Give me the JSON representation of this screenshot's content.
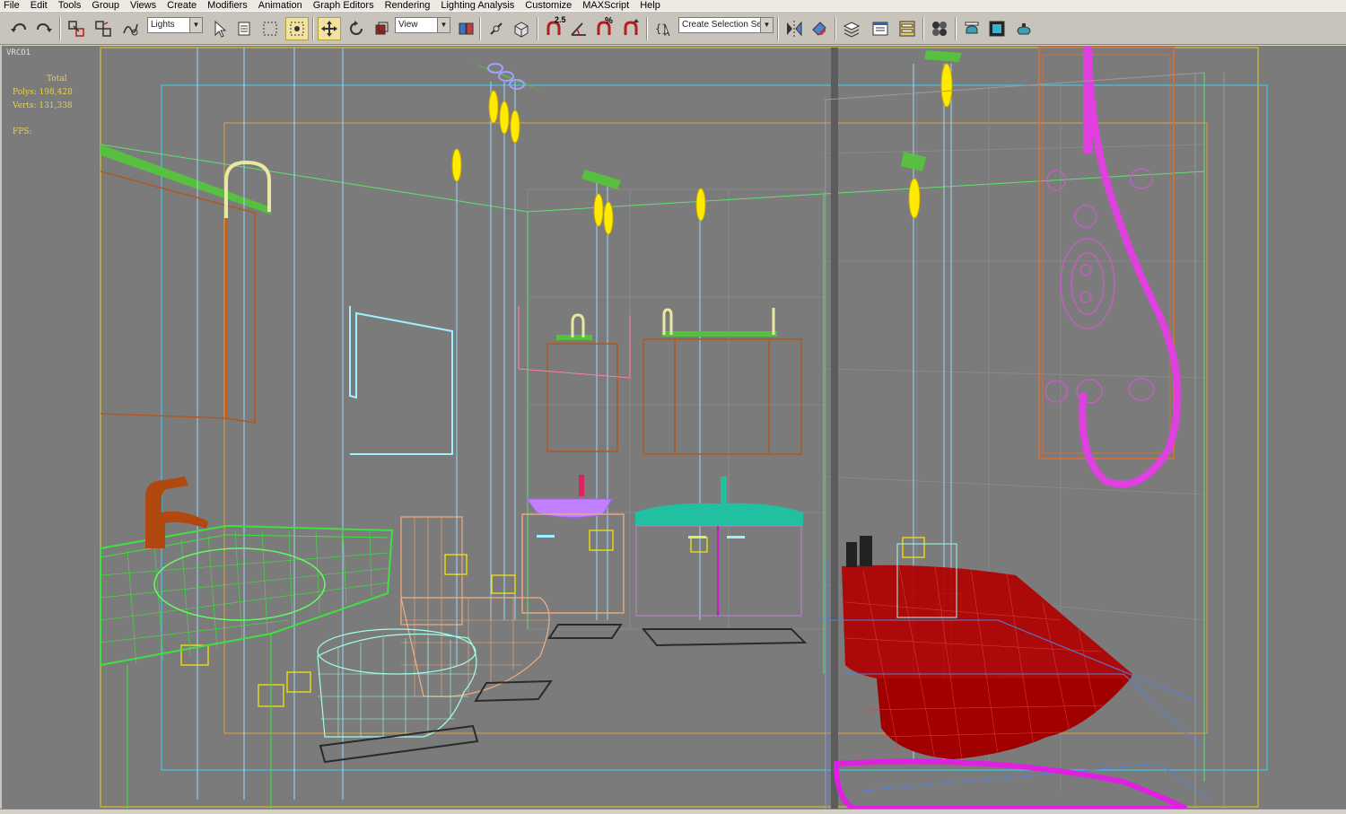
{
  "menu": [
    "File",
    "Edit",
    "Tools",
    "Group",
    "Views",
    "Create",
    "Modifiers",
    "Animation",
    "Graph Editors",
    "Rendering",
    "Lighting Analysis",
    "Customize",
    "MAXScript",
    "Help"
  ],
  "toolbar": {
    "filter_value": "Lights",
    "ref_coord_value": "View",
    "selection_set_placeholder": "Create Selection Set",
    "snap_angle_label": "2.5",
    "percent_snap_label": "%"
  },
  "viewport": {
    "label": "VRCO1",
    "stats": {
      "total_label": "Total",
      "polys": "Polys: 198,428",
      "verts": "Verts: 131,338",
      "fps": "FPS:"
    }
  },
  "colors": {
    "viewport_bg": "#7b7b7b",
    "safe_frame_outer": "#d8c030",
    "safe_frame_inner": "#40c8e0",
    "vanity_green": "#40e040",
    "toilet_cyan": "#a0ffe8",
    "toilet_peach": "#f0b080",
    "bathtub_red": "#b00000",
    "shower_magenta": "#e040e0",
    "light_yellow": "#ffea00",
    "sink_teal": "#20c0a0",
    "faucet_brown": "#b04810"
  }
}
